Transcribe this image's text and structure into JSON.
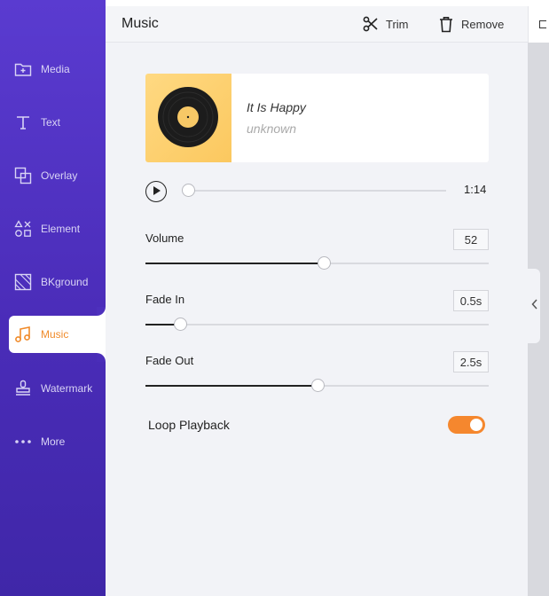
{
  "sidebar": {
    "items": [
      {
        "label": "Media",
        "icon": "folder-plus-icon"
      },
      {
        "label": "Text",
        "icon": "text-t-icon"
      },
      {
        "label": "Overlay",
        "icon": "overlay-icon"
      },
      {
        "label": "Element",
        "icon": "shapes-icon"
      },
      {
        "label": "BKground",
        "icon": "background-icon"
      },
      {
        "label": "Music",
        "icon": "music-note-icon",
        "active": true
      },
      {
        "label": "Watermark",
        "icon": "stamp-icon"
      },
      {
        "label": "More",
        "icon": "more-dots-icon"
      }
    ],
    "active_color": "#f08b2a"
  },
  "panel": {
    "title": "Music",
    "trim_label": "Trim",
    "remove_label": "Remove"
  },
  "track": {
    "title": "It Is Happy",
    "artist": "unknown"
  },
  "player": {
    "duration": "1:14",
    "position_fraction": 0.02
  },
  "controls": {
    "volume": {
      "label": "Volume",
      "value": "52",
      "fraction": 0.52
    },
    "fade_in": {
      "label": "Fade In",
      "value": "0.5s",
      "fraction": 0.1
    },
    "fade_out": {
      "label": "Fade Out",
      "value": "2.5s",
      "fraction": 0.5
    }
  },
  "loop": {
    "label": "Loop Playback",
    "enabled": true,
    "color": "#f5872e"
  }
}
